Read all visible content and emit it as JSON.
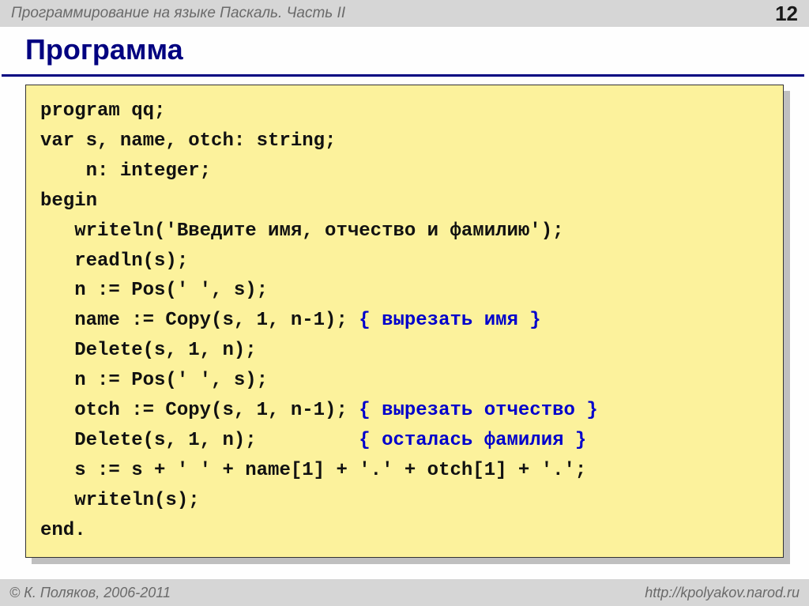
{
  "header": {
    "title": "Программирование на языке Паскаль. Часть II",
    "page_number": "12"
  },
  "title": "Программа",
  "code": {
    "l1": "program qq;",
    "l2": "var s, name, otch: string;",
    "l3": "    n: integer;",
    "l4": "begin",
    "l5": "   writeln('Введите имя, отчество и фамилию');",
    "l6": "   readln(s);",
    "l7": "   n := Pos(' ', s);",
    "l8a": "   name := Copy(s, 1, n-1); ",
    "l8c": "{ вырезать имя }",
    "l9": "   Delete(s, 1, n);",
    "l10": "   n := Pos(' ', s);",
    "l11a": "   otch := Copy(s, 1, n-1); ",
    "l11c": "{ вырезать отчество }",
    "l12a": "   Delete(s, 1, n);         ",
    "l12c": "{ осталась фамилия }",
    "l13": "   s := s + ' ' + name[1] + '.' + otch[1] + '.';",
    "l14": "   writeln(s);",
    "l15": "end."
  },
  "footer": {
    "copyright": "© К. Поляков, 2006-2011",
    "url": "http://kpolyakov.narod.ru"
  }
}
